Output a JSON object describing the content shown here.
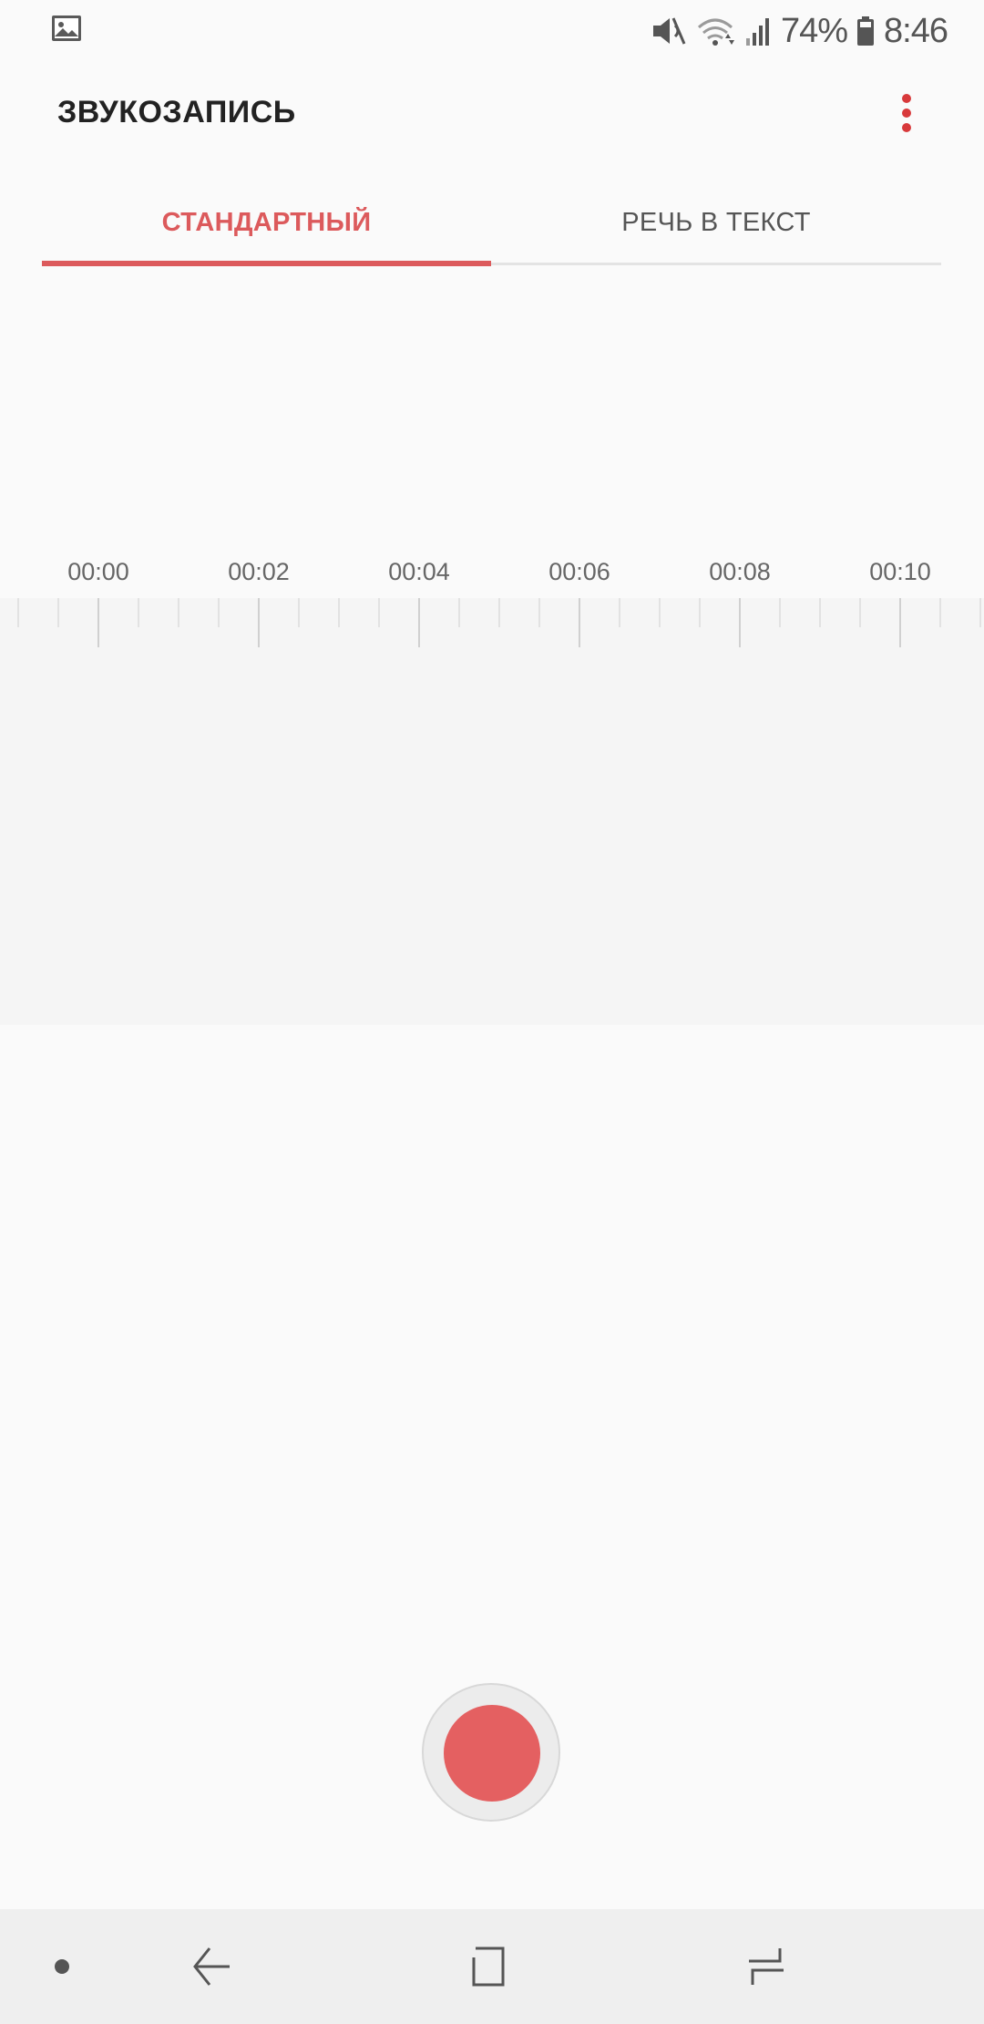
{
  "status_bar": {
    "battery_percent_text": "74%",
    "time": "8:46",
    "icons": [
      "gallery-icon",
      "vibrate-mute-icon",
      "wifi-icon",
      "signal-icon",
      "battery-icon"
    ]
  },
  "app_bar": {
    "title": "ЗВУКОЗАПИСЬ",
    "more_icon": "more-vert-icon"
  },
  "tabs": [
    {
      "label": "СТАНДАРТНЫЙ",
      "selected": true
    },
    {
      "label": "РЕЧЬ В ТЕКСТ",
      "selected": false
    }
  ],
  "timeline": {
    "labels": [
      "00:00",
      "00:02",
      "00:04",
      "00:06",
      "00:08",
      "00:10"
    ]
  },
  "controls": {
    "record_icon": "record-icon"
  },
  "nav_bar": {
    "icons": [
      "dot-icon",
      "back-icon",
      "home-icon",
      "recents-icon"
    ]
  },
  "colors": {
    "accent": "#dc5a5c",
    "record": "#e46061",
    "background": "#fafafa",
    "wave_background": "#f5f5f5",
    "nav_background": "#efefef"
  }
}
